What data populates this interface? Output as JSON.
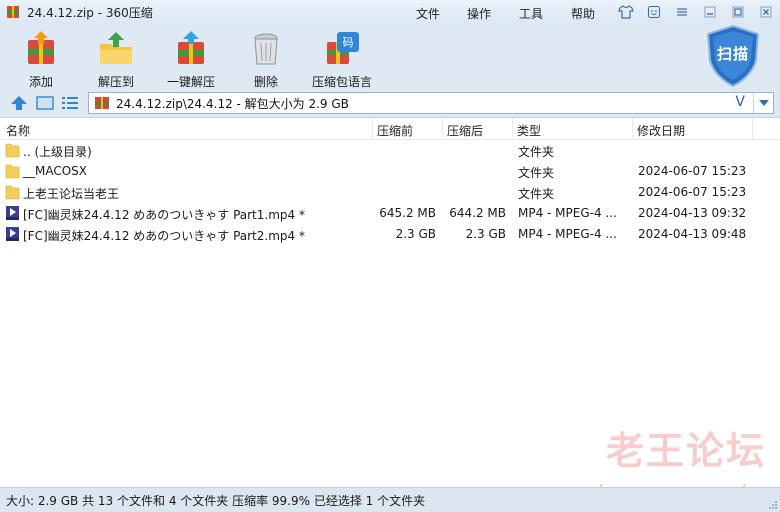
{
  "window": {
    "title": "24.4.12.zip - 360压缩",
    "menu": [
      "文件",
      "操作",
      "工具",
      "帮助"
    ]
  },
  "toolbar": {
    "add": "添加",
    "extract_to": "解压到",
    "one_click_extract": "一键解压",
    "delete": "删除",
    "encoding": "压缩包语言",
    "scan": "扫描"
  },
  "address": {
    "path": "24.4.12.zip\\24.4.12 - 解包大小为 2.9 GB",
    "v_label": "V"
  },
  "columns": {
    "name": "名称",
    "compressed_before": "压缩前",
    "compressed_after": "压缩后",
    "type": "类型",
    "modified": "修改日期"
  },
  "files": [
    {
      "name": ".. (上级目录)",
      "before": "",
      "after": "",
      "type": "文件夹",
      "date": "",
      "icon": "folder-icon"
    },
    {
      "name": "__MACOSX",
      "before": "",
      "after": "",
      "type": "文件夹",
      "date": "2024-06-07 15:23",
      "icon": "folder-icon"
    },
    {
      "name": "上老王论坛当老王",
      "before": "",
      "after": "",
      "type": "文件夹",
      "date": "2024-06-07 15:23",
      "icon": "folder-icon"
    },
    {
      "name": "[FC]幽灵妹24.4.12 めあのついきゃす Part1.mp4 *",
      "before": "645.2 MB",
      "after": "644.2 MB",
      "type": "MP4 - MPEG-4 ...",
      "date": "2024-04-13 09:32",
      "icon": "mp4-file-icon"
    },
    {
      "name": "[FC]幽灵妹24.4.12 めあのついきゃす Part2.mp4 *",
      "before": "2.3 GB",
      "after": "2.3 GB",
      "type": "MP4 - MPEG-4 ...",
      "date": "2024-04-13 09:48",
      "icon": "mp4-file-icon"
    }
  ],
  "watermark": {
    "line1": "老王论坛",
    "line2": "laowang.vip"
  },
  "status": {
    "text": "大小: 2.9 GB 共 13 个文件和 4 个文件夹 压缩率 99.9% 已经选择 1 个文件夹"
  },
  "colors": {
    "accent_blue": "#2a6fc9",
    "folder_yellow": "#f5cd5a",
    "watermark_red": "#e84848"
  }
}
